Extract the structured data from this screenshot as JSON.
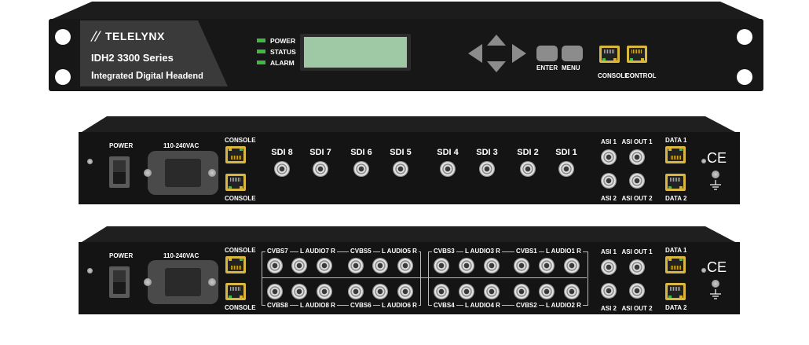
{
  "front": {
    "brand": "TELELYNX",
    "model": "IDH2 3300 Series",
    "desc_parts": [
      "I",
      "ntegrated ",
      "D",
      "igital ",
      "H",
      "eadend"
    ],
    "leds": [
      {
        "label": "POWER",
        "color": "#3dbb3d"
      },
      {
        "label": "STATUS",
        "color": "#3dbb3d"
      },
      {
        "label": "ALARM",
        "color": "#3dbb3d"
      }
    ],
    "enter_label": "ENTER",
    "menu_label": "MENU",
    "console_label": "CONSOLE",
    "control_label": "CONTROL",
    "lcd_color": "#9fc8a5"
  },
  "rear1": {
    "power_label": "POWER",
    "voltage_label": "110-240VAC",
    "console_label_top": "CONSOLE",
    "console_label_bottom": "CONSOLE",
    "sdi": [
      "SDI 8",
      "SDI 7",
      "SDI 6",
      "SDI 5",
      "SDI 4",
      "SDI 3",
      "SDI 2",
      "SDI 1"
    ],
    "asi1": "ASI 1",
    "asi_out1": "ASI OUT 1",
    "asi2": "ASI 2",
    "asi_out2": "ASI OUT 2",
    "data1": "DATA 1",
    "data2": "DATA 2",
    "ce": "CE"
  },
  "rear2": {
    "power_label": "POWER",
    "voltage_label": "110-240VAC",
    "console_label_top": "CONSOLE",
    "console_label_bottom": "CONSOLE",
    "groups_top": [
      {
        "cvbs": "CVBS7",
        "audio": "L AUDIO7 R"
      },
      {
        "cvbs": "CVBS5",
        "audio": "L AUDIO5 R"
      },
      {
        "cvbs": "CVBS3",
        "audio": "L AUDIO3 R"
      },
      {
        "cvbs": "CVBS1",
        "audio": "L AUDIO1 R"
      }
    ],
    "groups_bottom": [
      {
        "cvbs": "CVBS8",
        "audio": "L AUDIO8 R"
      },
      {
        "cvbs": "CVBS6",
        "audio": "L AUDIO6 R"
      },
      {
        "cvbs": "CVBS4",
        "audio": "L AUDIO4 R"
      },
      {
        "cvbs": "CVBS2",
        "audio": "L AUDIO2 R"
      }
    ],
    "asi1": "ASI 1",
    "asi_out1": "ASI OUT 1",
    "asi2": "ASI 2",
    "asi_out2": "ASI OUT 2",
    "data1": "DATA 1",
    "data2": "DATA 2",
    "ce": "CE"
  }
}
